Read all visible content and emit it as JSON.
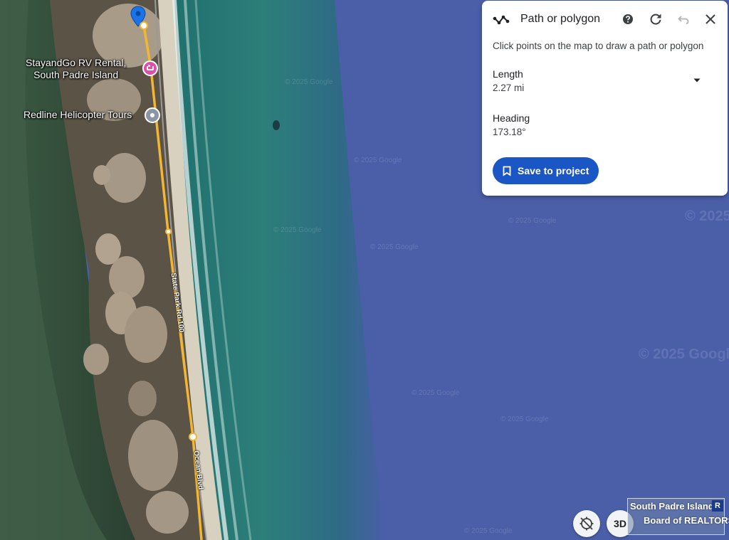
{
  "panel": {
    "title": "Path or polygon",
    "instruction": "Click points on the map to draw a path or polygon",
    "length_label": "Length",
    "length_value": "2.27 mi",
    "heading_label": "Heading",
    "heading_value": "173.18°",
    "save_label": "Save to project"
  },
  "map": {
    "places": {
      "rv_rental": "StayandGo RV Rental,\nSouth Padre Island",
      "helicopter": "Redline Helicopter Tours"
    },
    "roads": {
      "state_park_rd": "State Park Rd 100",
      "ocean_blvd": "Ocean Blvd"
    },
    "watermark": "© 2025 Google",
    "path_color": "#f2b632",
    "marker_color": "#1a73e8"
  },
  "controls": {
    "three_d_label": "3D"
  },
  "overlay": {
    "line1": "South Padre Island",
    "line2": "Board of REALTORS",
    "mark": "R"
  },
  "icons": {
    "path": "path-polygon-icon",
    "help": "help-icon",
    "redo": "redo-icon",
    "undo": "undo-icon",
    "close": "close-icon",
    "dropdown": "caret-down-icon",
    "bookmark": "bookmark-icon",
    "compass": "compass-off-icon"
  }
}
